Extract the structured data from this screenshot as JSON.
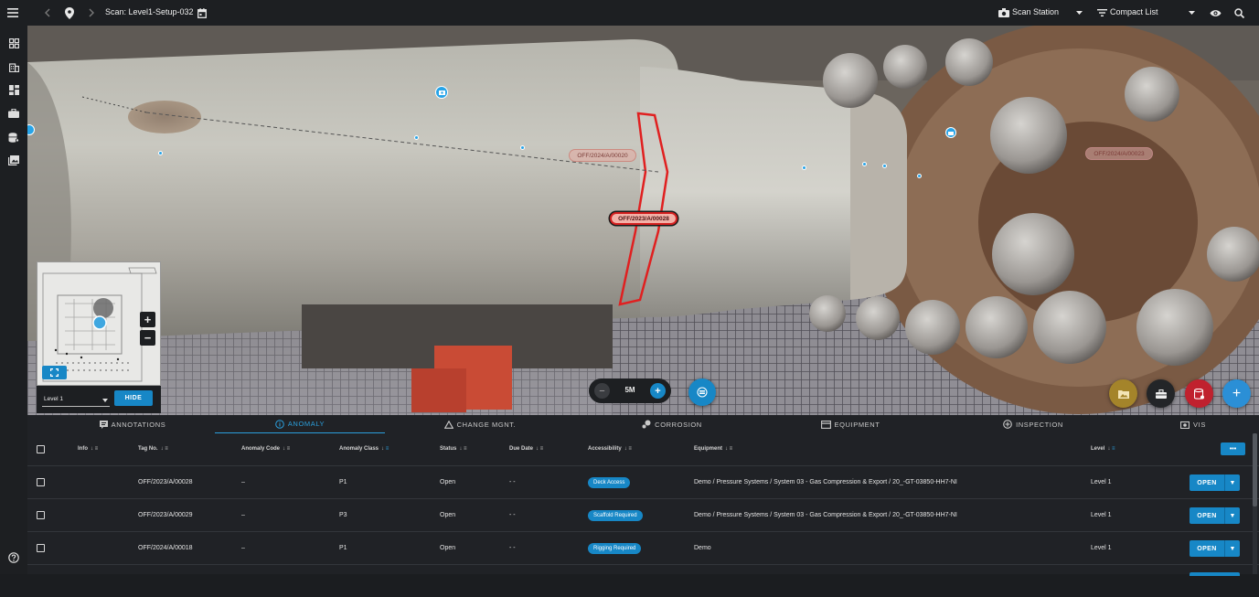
{
  "topbar": {
    "scan_title": "Scan: Level1-Setup-032",
    "scan_station_label": "Scan Station",
    "compact_list_label": "Compact List"
  },
  "viewer": {
    "tags": [
      {
        "label": "OFF/2024/A/00020",
        "highlight": false
      },
      {
        "label": "OFF/2023/A/00028",
        "highlight": true
      },
      {
        "label": "OFF/2024/A/00023",
        "highlight": false
      }
    ],
    "zoom_label": "5M",
    "minimap_level": "Level 1",
    "hide_button": "HIDE",
    "colors": {
      "accent": "#1787c6",
      "highlight": "#e02020",
      "fab_gold": "#a4842a",
      "fab_red": "#c0212e",
      "fab_blue": "#2b8fd6"
    }
  },
  "tabs": [
    {
      "label": "ANNOTATIONS",
      "icon": "annotation-icon",
      "active": false
    },
    {
      "label": "ANOMALY",
      "icon": "info-circle-icon",
      "active": true
    },
    {
      "label": "CHANGE MGNT.",
      "icon": "triangle-icon",
      "active": false
    },
    {
      "label": "CORROSION",
      "icon": "corrosion-icon",
      "active": false
    },
    {
      "label": "EQUIPMENT",
      "icon": "equipment-icon",
      "active": false
    },
    {
      "label": "INSPECTION",
      "icon": "plus-circle-icon",
      "active": false
    },
    {
      "label": "VIS",
      "icon": "camera-icon",
      "active": false
    }
  ],
  "table": {
    "headers": [
      "Info",
      "Tag No.",
      "Anomaly Code",
      "Anomaly Class",
      "Status",
      "Due Date",
      "Accessibility",
      "Equipment",
      "Level"
    ],
    "more_label": "•••",
    "open_label": "OPEN",
    "rows": [
      {
        "tag": "OFF/2023/A/00028",
        "code": "–",
        "class": "P1",
        "status": "Open",
        "due": "- -",
        "access": "Deck Access",
        "equipment": "Demo / Pressure Systems / System 03 - Gas Compression & Export / 20_-GT-03850-HH7-NI",
        "level": "Level 1"
      },
      {
        "tag": "OFF/2023/A/00029",
        "code": "–",
        "class": "P3",
        "status": "Open",
        "due": "- -",
        "access": "Scaffold Required",
        "equipment": "Demo / Pressure Systems / System 03 - Gas Compression & Export / 20_-GT-03850-HH7-NI",
        "level": "Level 1"
      },
      {
        "tag": "OFF/2024/A/00018",
        "code": "–",
        "class": "P1",
        "status": "Open",
        "due": "- -",
        "access": "Rigging Required",
        "equipment": "Demo",
        "level": "Level 1"
      }
    ]
  }
}
